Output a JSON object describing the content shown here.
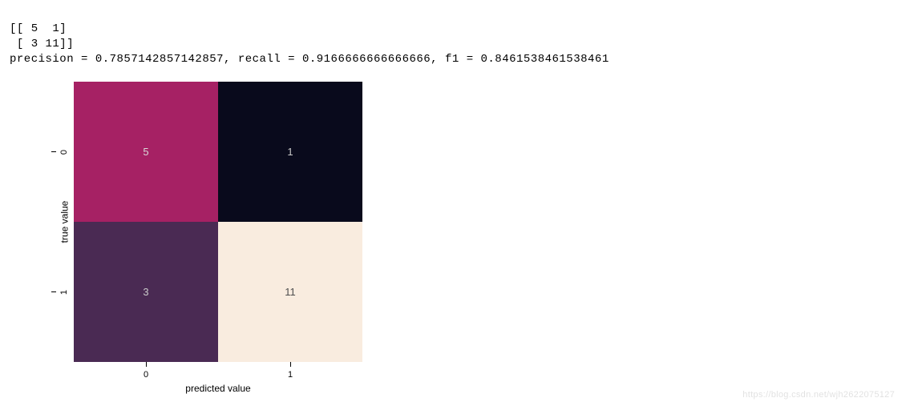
{
  "console": {
    "matrix_line1": "[[ 5  1]",
    "matrix_line2": " [ 3 11]]",
    "metrics_line": "precision = 0.7857142857142857, recall = 0.9166666666666666, f1 = 0.8461538461538461"
  },
  "chart_data": {
    "type": "heatmap",
    "title": "",
    "xlabel": "predicted value",
    "ylabel": "true value",
    "x_categories": [
      "0",
      "1"
    ],
    "y_categories": [
      "0",
      "1"
    ],
    "values": [
      [
        5,
        1
      ],
      [
        3,
        11
      ]
    ],
    "cell_colors": [
      [
        "#a62164",
        "#090a1c"
      ],
      [
        "#4a2a53",
        "#f9ecdf"
      ]
    ],
    "cell_text_colors": [
      [
        "#d9d9d9",
        "#c9c9c9"
      ],
      [
        "#c9c9c9",
        "#4d4d4d"
      ]
    ],
    "ylim": [
      0,
      2
    ],
    "xlim": [
      0,
      2
    ]
  },
  "watermark": "https://blog.csdn.net/wjh2622075127"
}
